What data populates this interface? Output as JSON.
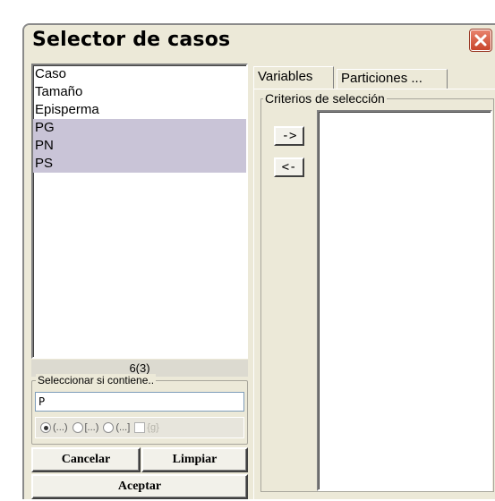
{
  "window": {
    "title": "Selector de casos"
  },
  "variables_list": {
    "items": [
      {
        "label": "Caso",
        "selected": false
      },
      {
        "label": "Tamaño",
        "selected": false
      },
      {
        "label": "Episperma",
        "selected": false
      },
      {
        "label": "PG",
        "selected": true
      },
      {
        "label": "PN",
        "selected": true
      },
      {
        "label": "PS",
        "selected": true
      }
    ],
    "count_label": "6(3)"
  },
  "filter": {
    "legend": "Seleccionar si contiene..",
    "value": "P",
    "options": [
      {
        "label": "(...)",
        "checked": true
      },
      {
        "label": "[...)",
        "checked": false
      },
      {
        "label": "(...]",
        "checked": false
      }
    ],
    "regex_label": "{g}"
  },
  "buttons": {
    "cancel": "Cancelar",
    "clear": "Limpiar",
    "accept": "Aceptar"
  },
  "tabs": [
    {
      "label": "Variables",
      "active": true
    },
    {
      "label": "Particiones ...",
      "active": false
    }
  ],
  "criteria": {
    "legend": "Criterios de selección",
    "add_label": "->",
    "remove_label": "<-",
    "items": []
  },
  "colors": {
    "window_bg": "#ece9d8",
    "selection": "#c9c4d7",
    "close_button": "#d5583c"
  }
}
